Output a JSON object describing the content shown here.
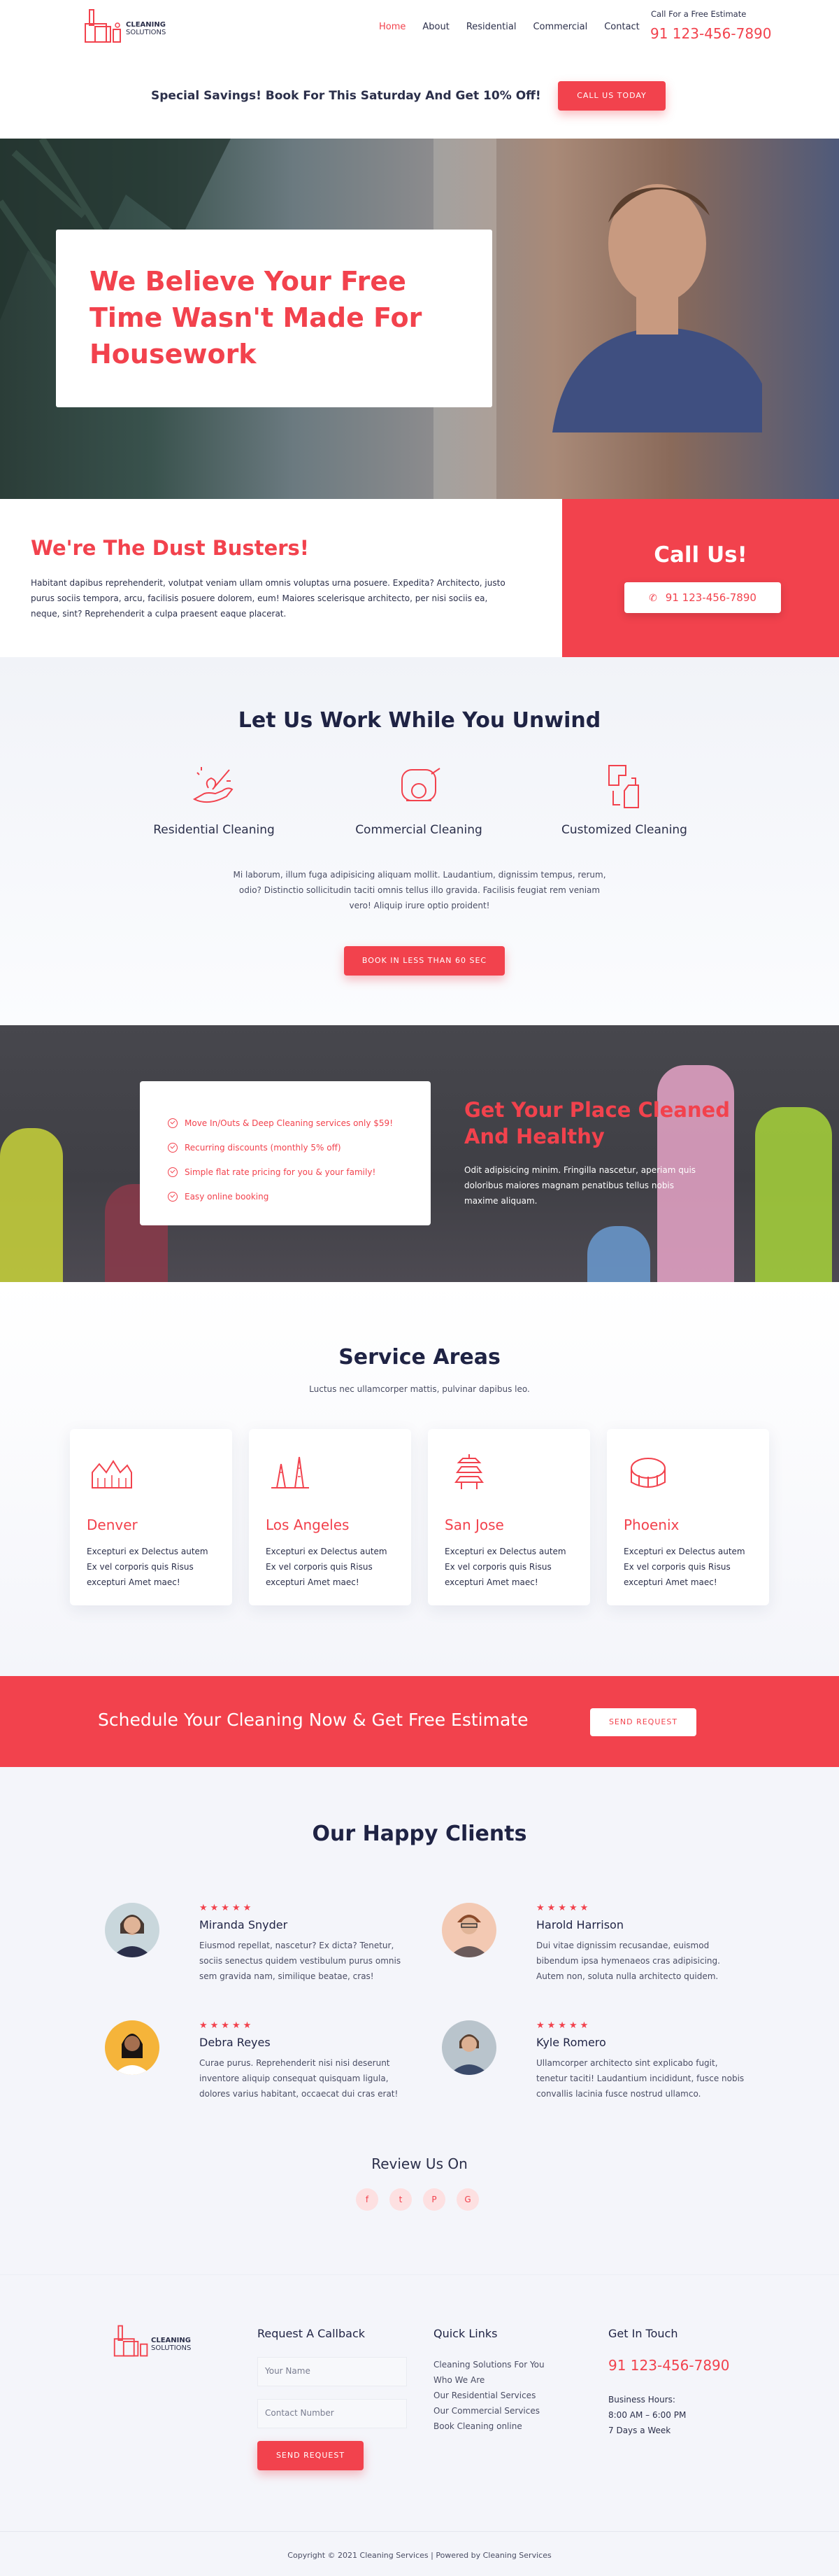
{
  "header": {
    "logo_line1": "CLEANING",
    "logo_line2": "SOLUTIONS",
    "nav": [
      "Home",
      "About",
      "Residential",
      "Commercial",
      "Contact"
    ],
    "estimate_label": "Call For a Free Estimate",
    "phone": "91 123-456-7890"
  },
  "promo": {
    "text": "Special Savings! Book For This Saturday And Get 10% Off!",
    "button": "CALL US TODAY"
  },
  "hero": {
    "title": "We Believe Your Free Time Wasn't Made For Housework"
  },
  "dust": {
    "title": "We're The Dust Busters!",
    "text": "Habitant dapibus reprehenderit, volutpat veniam ullam omnis voluptas urna posuere. Expedita? Architecto, justo purus sociis tempora, arcu, facilisis posuere dolorem, eum! Maiores scelerisque architecto, per nisi sociis ea, neque, sint? Reprehenderit a culpa praesent eaque placerat."
  },
  "callus": {
    "title": "Call Us!",
    "phone": "91 123-456-7890"
  },
  "work": {
    "title": "Let Us Work While You Unwind",
    "services": [
      "Residential Cleaning",
      "Commercial Cleaning",
      "Customized Cleaning"
    ],
    "text": "Mi laborum, illum fuga adipisicing aliquam mollit. Laudantium, dignissim tempus, rerum, odio? Distinctio sollicitudin taciti omnis tellus illo gravida. Facilisis feugiat rem veniam vero! Aliquip irure optio proident!",
    "button": "BOOK IN LESS THAN 60 SEC"
  },
  "healthy": {
    "list": [
      "Move In/Outs & Deep Cleaning services only $59!",
      "Recurring discounts (monthly 5% off)",
      "Simple flat rate pricing for you & your family!",
      "Easy online booking"
    ],
    "title": "Get Your Place Cleaned And Healthy",
    "text": "Odit adipisicing minim. Fringilla nascetur, aperiam quis doloribus maiores magnam penatibus tellus nobis maxime aliquam."
  },
  "areas": {
    "title": "Service Areas",
    "subtitle": "Luctus nec ullamcorper mattis, pulvinar dapibus leo.",
    "cards": [
      {
        "city": "Denver",
        "text": "Excepturi ex Delectus autem Ex vel corporis quis Risus excepturi Amet maec!"
      },
      {
        "city": "Los Angeles",
        "text": "Excepturi ex Delectus autem Ex vel corporis quis Risus excepturi Amet maec!"
      },
      {
        "city": "San Jose",
        "text": "Excepturi ex Delectus autem Ex vel corporis quis Risus excepturi Amet maec!"
      },
      {
        "city": "Phoenix",
        "text": "Excepturi ex Delectus autem Ex vel corporis quis Risus excepturi Amet maec!"
      }
    ]
  },
  "schedule": {
    "text": "Schedule Your Cleaning Now & Get Free Estimate",
    "button": "SEND REQUEST"
  },
  "clients": {
    "title": "Our Happy Clients",
    "stars": "★★★★★",
    "reviews": [
      {
        "name": "Miranda Snyder",
        "text": "Eiusmod repellat, nascetur? Ex dicta? Tenetur, sociis senectus quidem vestibulum purus omnis sem gravida nam, similique beatae, cras!"
      },
      {
        "name": "Harold Harrison",
        "text": "Dui vitae dignissim recusandae, euismod bibendum ipsa hymenaeos cras adipisicing. Autem non, soluta nulla architecto quidem."
      },
      {
        "name": "Debra Reyes",
        "text": "Curae purus. Reprehenderit nisi nisi deserunt inventore aliquip consequat quisquam ligula, dolores varius habitant, occaecat dui cras erat!"
      },
      {
        "name": "Kyle Romero",
        "text": "Ullamcorper architecto sint explicabo fugit, tenetur taciti! Laudantium incididunt, fusce nobis convallis lacinia fusce nostrud ullamco."
      }
    ],
    "review_on": "Review Us On",
    "socials": [
      "f",
      "t",
      "P",
      "G"
    ]
  },
  "footer": {
    "callback_title": "Request A Callback",
    "name_placeholder": "Your Name",
    "number_placeholder": "Contact Number",
    "button": "SEND REQUEST",
    "links_title": "Quick Links",
    "links": [
      "Cleaning Solutions For You",
      "Who We Are",
      "Our Residential Services",
      "Our Commercial Services",
      "Book Cleaning online"
    ],
    "touch_title": "Get In Touch",
    "phone": "91 123-456-7890",
    "hours_label": "Business Hours:",
    "hours": "8:00 AM – 6:00 PM",
    "days": "7 Days a Week",
    "copyright": "Copyright © 2021 Cleaning Services | Powered by Cleaning Services"
  },
  "colors": {
    "accent": "#f2424d",
    "heading": "#1f2344",
    "light_bg": "#f4f5fa"
  }
}
